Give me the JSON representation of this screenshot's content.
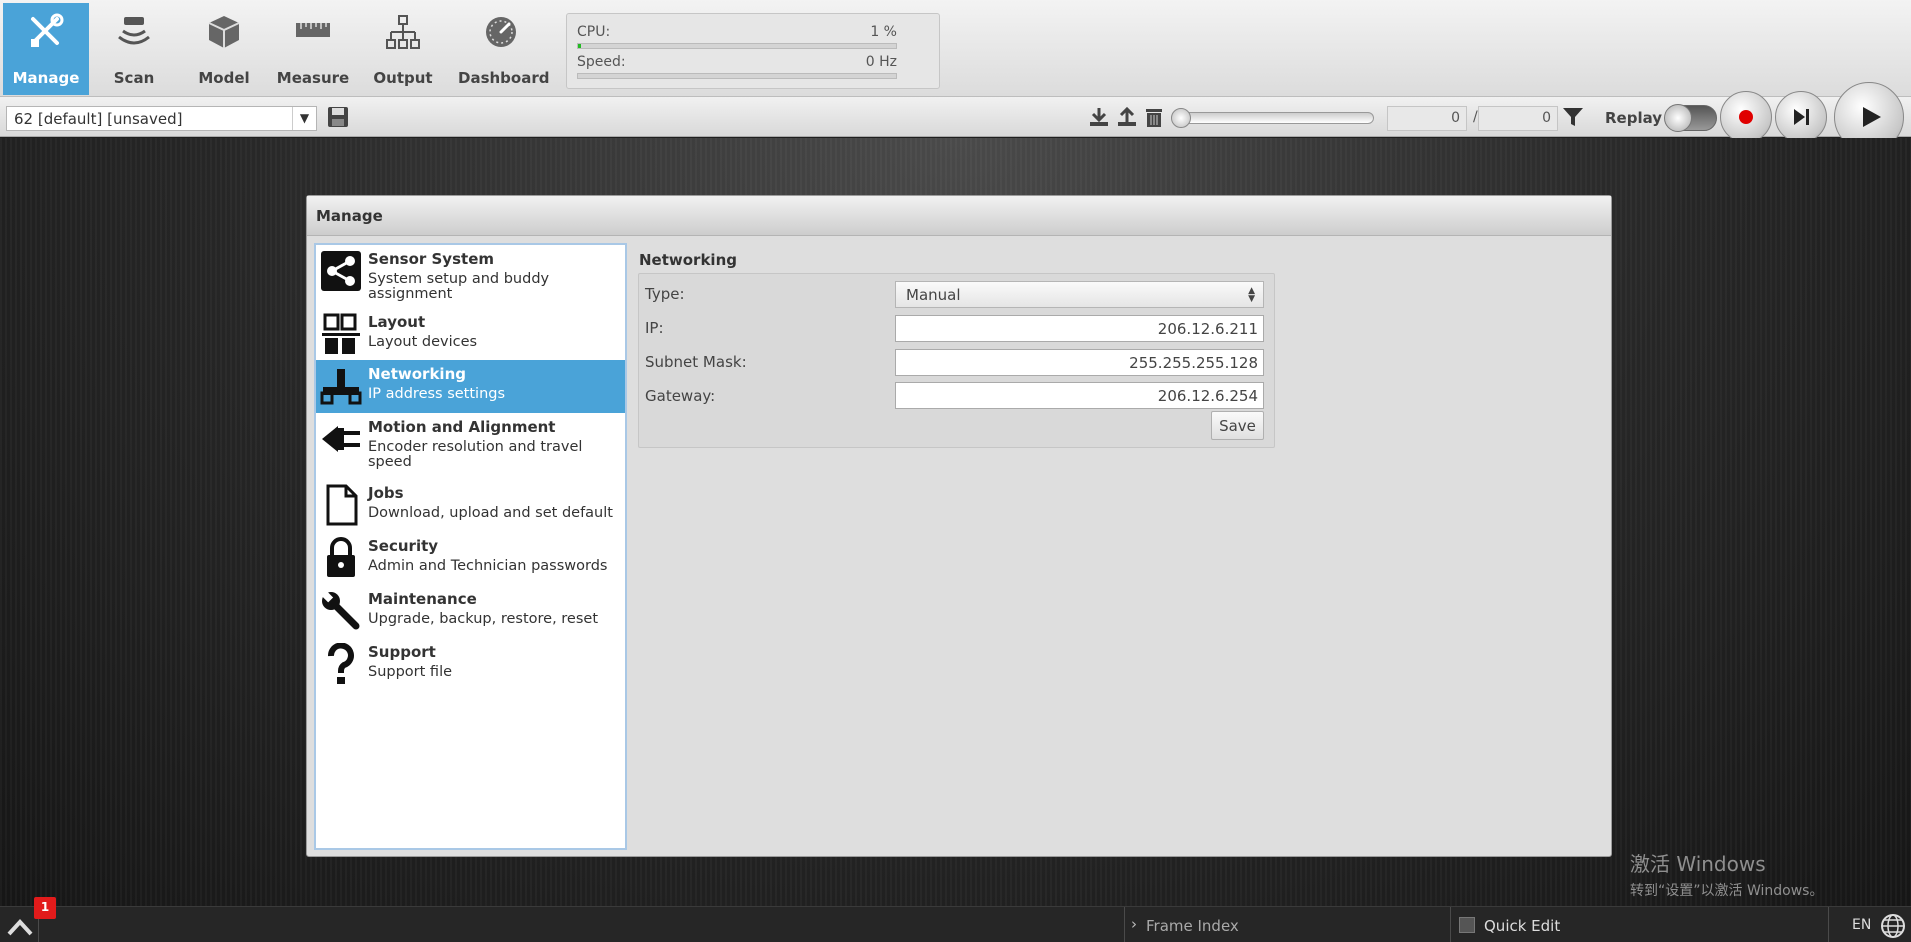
{
  "nav": {
    "tabs": [
      {
        "label": "Manage",
        "icon": "tools-icon",
        "active": true
      },
      {
        "label": "Scan",
        "icon": "scan-icon"
      },
      {
        "label": "Model",
        "icon": "model-icon"
      },
      {
        "label": "Measure",
        "icon": "measure-icon"
      },
      {
        "label": "Output",
        "icon": "output-icon"
      },
      {
        "label": "Dashboard",
        "icon": "dashboard-icon"
      }
    ]
  },
  "performance": {
    "cpu_label": "CPU:",
    "cpu_value": "1 %",
    "cpu_fraction": 0.01,
    "speed_label": "Speed:",
    "speed_value": "0 Hz",
    "speed_fraction": 0
  },
  "toolbar": {
    "job_name": "62 [default] [unsaved]",
    "frame_current": "0",
    "frame_separator": "/",
    "frame_total": "0",
    "replay_label": "Replay"
  },
  "dialog": {
    "title": "Manage",
    "sidebar": [
      {
        "title": "Sensor System",
        "desc": "System setup and buddy assignment",
        "icon": "share-nodes-icon"
      },
      {
        "title": "Layout",
        "desc": "Layout devices",
        "icon": "layout-icon"
      },
      {
        "title": "Networking",
        "desc": "IP address settings",
        "icon": "network-icon",
        "active": true
      },
      {
        "title": "Motion and Alignment",
        "desc": "Encoder resolution and travel speed",
        "icon": "plug-icon"
      },
      {
        "title": "Jobs",
        "desc": "Download, upload and set default",
        "icon": "document-icon"
      },
      {
        "title": "Security",
        "desc": "Admin and Technician passwords",
        "icon": "lock-icon"
      },
      {
        "title": "Maintenance",
        "desc": "Upgrade, backup, restore, reset",
        "icon": "wrench-icon"
      },
      {
        "title": "Support",
        "desc": "Support file",
        "icon": "question-icon"
      }
    ],
    "networking": {
      "title": "Networking",
      "type_label": "Type:",
      "type_value": "Manual",
      "ip_label": "IP:",
      "ip_value": "206.12.6.211",
      "mask_label": "Subnet Mask:",
      "mask_value": "255.255.255.128",
      "gateway_label": "Gateway:",
      "gateway_value": "206.12.6.254",
      "save_label": "Save"
    }
  },
  "watermark": {
    "line1": "激活 Windows",
    "line2": "转到“设置”以激活 Windows。"
  },
  "statusbar": {
    "notification_count": "1",
    "frame_index_label": "Frame Index",
    "quick_edit_label": "Quick Edit",
    "language": "EN"
  },
  "colors": {
    "accent": "#4aa3d8",
    "record": "#e00000",
    "cpu_bar": "#22bb22",
    "badge": "#e21b1b"
  }
}
